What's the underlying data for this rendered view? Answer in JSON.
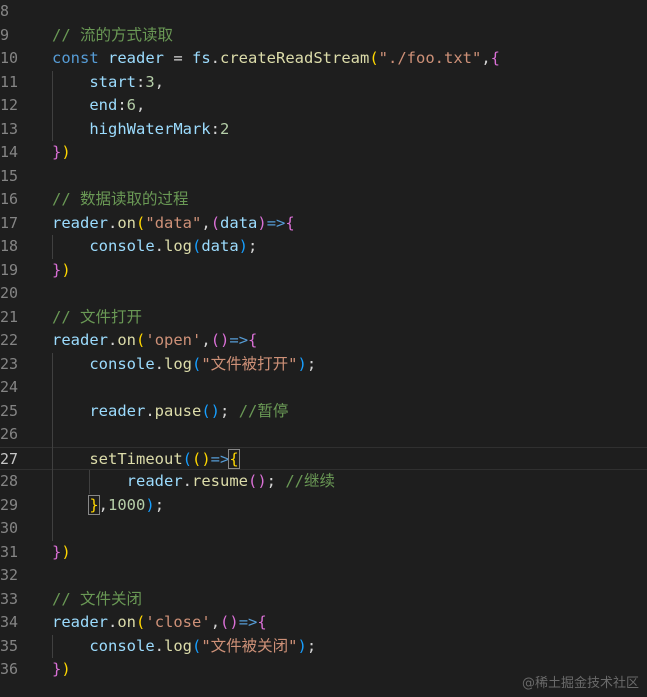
{
  "editor": {
    "lines": [
      {
        "number": "8",
        "tokens": []
      },
      {
        "number": "9",
        "tokens": [
          {
            "t": "// 流的方式读取",
            "c": "comment"
          }
        ]
      },
      {
        "number": "10",
        "tokens": [
          {
            "t": "const ",
            "c": "keyword"
          },
          {
            "t": "reader",
            "c": "var"
          },
          {
            "t": " = ",
            "c": "punct"
          },
          {
            "t": "fs",
            "c": "var"
          },
          {
            "t": ".",
            "c": "punct"
          },
          {
            "t": "createReadStream",
            "c": "func"
          },
          {
            "t": "(",
            "c": "b2"
          },
          {
            "t": "\"./foo.txt\"",
            "c": "string"
          },
          {
            "t": ",",
            "c": "punct"
          },
          {
            "t": "{",
            "c": "b1"
          }
        ]
      },
      {
        "number": "11",
        "tokens": [
          {
            "t": "    ",
            "c": "punct"
          },
          {
            "t": "start",
            "c": "var"
          },
          {
            "t": ":",
            "c": "punct"
          },
          {
            "t": "3",
            "c": "num"
          },
          {
            "t": ",",
            "c": "punct"
          }
        ]
      },
      {
        "number": "12",
        "tokens": [
          {
            "t": "    ",
            "c": "punct"
          },
          {
            "t": "end",
            "c": "var"
          },
          {
            "t": ":",
            "c": "punct"
          },
          {
            "t": "6",
            "c": "num"
          },
          {
            "t": ",",
            "c": "punct"
          }
        ]
      },
      {
        "number": "13",
        "tokens": [
          {
            "t": "    ",
            "c": "punct"
          },
          {
            "t": "highWaterMark",
            "c": "var"
          },
          {
            "t": ":",
            "c": "punct"
          },
          {
            "t": "2",
            "c": "num"
          }
        ]
      },
      {
        "number": "14",
        "tokens": [
          {
            "t": "}",
            "c": "b1"
          },
          {
            "t": ")",
            "c": "b2"
          }
        ]
      },
      {
        "number": "15",
        "tokens": []
      },
      {
        "number": "16",
        "tokens": [
          {
            "t": "// 数据读取的过程",
            "c": "comment"
          }
        ]
      },
      {
        "number": "17",
        "tokens": [
          {
            "t": "reader",
            "c": "var"
          },
          {
            "t": ".",
            "c": "punct"
          },
          {
            "t": "on",
            "c": "func"
          },
          {
            "t": "(",
            "c": "b2"
          },
          {
            "t": "\"data\"",
            "c": "string"
          },
          {
            "t": ",",
            "c": "punct"
          },
          {
            "t": "(",
            "c": "b1"
          },
          {
            "t": "data",
            "c": "var"
          },
          {
            "t": ")",
            "c": "b1"
          },
          {
            "t": "=>",
            "c": "keyword"
          },
          {
            "t": "{",
            "c": "b1"
          }
        ]
      },
      {
        "number": "18",
        "tokens": [
          {
            "t": "    ",
            "c": "punct"
          },
          {
            "t": "console",
            "c": "var"
          },
          {
            "t": ".",
            "c": "punct"
          },
          {
            "t": "log",
            "c": "func"
          },
          {
            "t": "(",
            "c": "b3"
          },
          {
            "t": "data",
            "c": "var"
          },
          {
            "t": ")",
            "c": "b3"
          },
          {
            "t": ";",
            "c": "punct"
          }
        ]
      },
      {
        "number": "19",
        "tokens": [
          {
            "t": "}",
            "c": "b1"
          },
          {
            "t": ")",
            "c": "b2"
          }
        ]
      },
      {
        "number": "20",
        "tokens": []
      },
      {
        "number": "21",
        "tokens": [
          {
            "t": "// 文件打开",
            "c": "comment"
          }
        ]
      },
      {
        "number": "22",
        "tokens": [
          {
            "t": "reader",
            "c": "var"
          },
          {
            "t": ".",
            "c": "punct"
          },
          {
            "t": "on",
            "c": "func"
          },
          {
            "t": "(",
            "c": "b2"
          },
          {
            "t": "'open'",
            "c": "string"
          },
          {
            "t": ",",
            "c": "punct"
          },
          {
            "t": "()",
            "c": "b1"
          },
          {
            "t": "=>",
            "c": "keyword"
          },
          {
            "t": "{",
            "c": "b1"
          }
        ]
      },
      {
        "number": "23",
        "tokens": [
          {
            "t": "    ",
            "c": "punct"
          },
          {
            "t": "console",
            "c": "var"
          },
          {
            "t": ".",
            "c": "punct"
          },
          {
            "t": "log",
            "c": "func"
          },
          {
            "t": "(",
            "c": "b3"
          },
          {
            "t": "\"文件被打开\"",
            "c": "string"
          },
          {
            "t": ")",
            "c": "b3"
          },
          {
            "t": ";",
            "c": "punct"
          }
        ]
      },
      {
        "number": "24",
        "tokens": []
      },
      {
        "number": "25",
        "tokens": [
          {
            "t": "    ",
            "c": "punct"
          },
          {
            "t": "reader",
            "c": "var"
          },
          {
            "t": ".",
            "c": "punct"
          },
          {
            "t": "pause",
            "c": "func"
          },
          {
            "t": "()",
            "c": "b3"
          },
          {
            "t": "; ",
            "c": "punct"
          },
          {
            "t": "//暂停",
            "c": "comment"
          }
        ]
      },
      {
        "number": "26",
        "tokens": []
      },
      {
        "number": "27",
        "tokens": [
          {
            "t": "    ",
            "c": "punct"
          },
          {
            "t": "setTimeout",
            "c": "func"
          },
          {
            "t": "(",
            "c": "b3"
          },
          {
            "t": "()",
            "c": "b2"
          },
          {
            "t": "=>",
            "c": "keyword"
          },
          {
            "t": "{",
            "c": "b2",
            "match": true
          }
        ]
      },
      {
        "number": "28",
        "tokens": [
          {
            "t": "        ",
            "c": "punct"
          },
          {
            "t": "reader",
            "c": "var"
          },
          {
            "t": ".",
            "c": "punct"
          },
          {
            "t": "resume",
            "c": "func"
          },
          {
            "t": "()",
            "c": "b1"
          },
          {
            "t": "; ",
            "c": "punct"
          },
          {
            "t": "//继续",
            "c": "comment"
          }
        ]
      },
      {
        "number": "29",
        "tokens": [
          {
            "t": "    ",
            "c": "punct"
          },
          {
            "t": "}",
            "c": "b2",
            "match": true
          },
          {
            "t": ",",
            "c": "punct"
          },
          {
            "t": "1000",
            "c": "num"
          },
          {
            "t": ")",
            "c": "b3"
          },
          {
            "t": ";",
            "c": "punct"
          }
        ]
      },
      {
        "number": "30",
        "tokens": []
      },
      {
        "number": "31",
        "tokens": [
          {
            "t": "}",
            "c": "b1"
          },
          {
            "t": ")",
            "c": "b2"
          }
        ]
      },
      {
        "number": "32",
        "tokens": []
      },
      {
        "number": "33",
        "tokens": [
          {
            "t": "// 文件关闭",
            "c": "comment"
          }
        ]
      },
      {
        "number": "34",
        "tokens": [
          {
            "t": "reader",
            "c": "var"
          },
          {
            "t": ".",
            "c": "punct"
          },
          {
            "t": "on",
            "c": "func"
          },
          {
            "t": "(",
            "c": "b2"
          },
          {
            "t": "'close'",
            "c": "string"
          },
          {
            "t": ",",
            "c": "punct"
          },
          {
            "t": "()",
            "c": "b1"
          },
          {
            "t": "=>",
            "c": "keyword"
          },
          {
            "t": "{",
            "c": "b1"
          }
        ]
      },
      {
        "number": "35",
        "tokens": [
          {
            "t": "    ",
            "c": "punct"
          },
          {
            "t": "console",
            "c": "var"
          },
          {
            "t": ".",
            "c": "punct"
          },
          {
            "t": "log",
            "c": "func"
          },
          {
            "t": "(",
            "c": "b3"
          },
          {
            "t": "\"文件被关闭\"",
            "c": "string"
          },
          {
            "t": ")",
            "c": "b3"
          },
          {
            "t": ";",
            "c": "punct"
          }
        ]
      },
      {
        "number": "36",
        "tokens": [
          {
            "t": "}",
            "c": "b1"
          },
          {
            "t": ")",
            "c": "b2"
          }
        ]
      }
    ],
    "active_line": "27"
  },
  "watermark": "@稀土掘金技术社区",
  "colors": {
    "background": "#1e1e1e",
    "comment": "#6a9955",
    "keyword": "#569cd6",
    "variable": "#9cdcfe",
    "function": "#dcdcaa",
    "string": "#ce9178",
    "number": "#b5cea8"
  }
}
